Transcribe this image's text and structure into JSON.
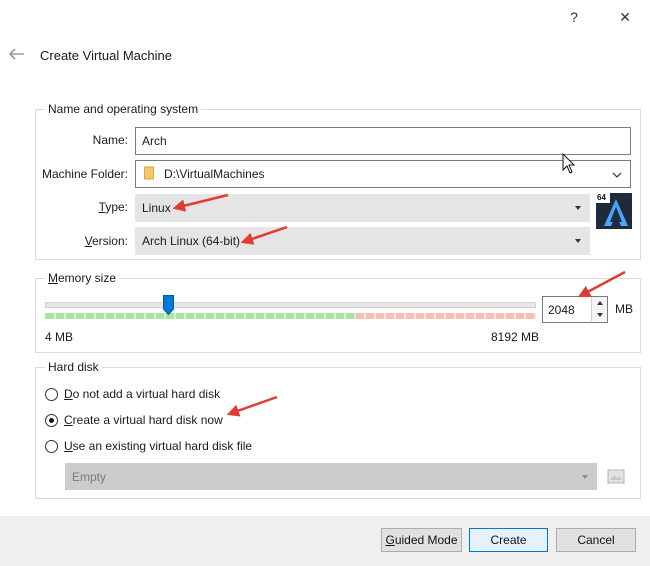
{
  "window": {
    "help_glyph": "?",
    "close_glyph": "✕",
    "title": "Create Virtual Machine"
  },
  "name_os": {
    "group_title": "Name and operating system",
    "name_label": "Name:",
    "name_value": "Arch",
    "folder_label": "Machine Folder:",
    "folder_value": "D:\\VirtualMachines",
    "type_label_u": "T",
    "type_label_rest": "ype:",
    "type_value": "Linux",
    "version_label_u": "V",
    "version_label_rest": "ersion:",
    "version_value": "Arch Linux (64-bit)",
    "os_badge": "64"
  },
  "memory": {
    "group_title_u": "M",
    "group_title_rest": "emory size",
    "min_label": "4 MB",
    "max_label": "8192 MB",
    "value": "2048",
    "unit": "MB",
    "slider_value_mb": 2048,
    "slider_min_mb": 4,
    "slider_max_mb": 8192
  },
  "hard_disk": {
    "group_title": "Hard disk",
    "options": [
      {
        "u": "D",
        "rest": "o not add a virtual hard disk",
        "checked": false
      },
      {
        "u": "C",
        "rest": "reate a virtual hard disk now",
        "checked": true
      },
      {
        "u": "U",
        "rest": "se an existing virtual hard disk file",
        "checked": false
      }
    ],
    "existing_file_value": "Empty"
  },
  "footer": {
    "guided_u": "G",
    "guided_rest": "uided Mode",
    "create_label": "Create",
    "cancel_label": "Cancel"
  },
  "colors": {
    "accent": "#0078d7",
    "annotation_arrow": "#e03c31",
    "slider_green": "#a8e6a0",
    "slider_red": "#f5c0b8"
  }
}
